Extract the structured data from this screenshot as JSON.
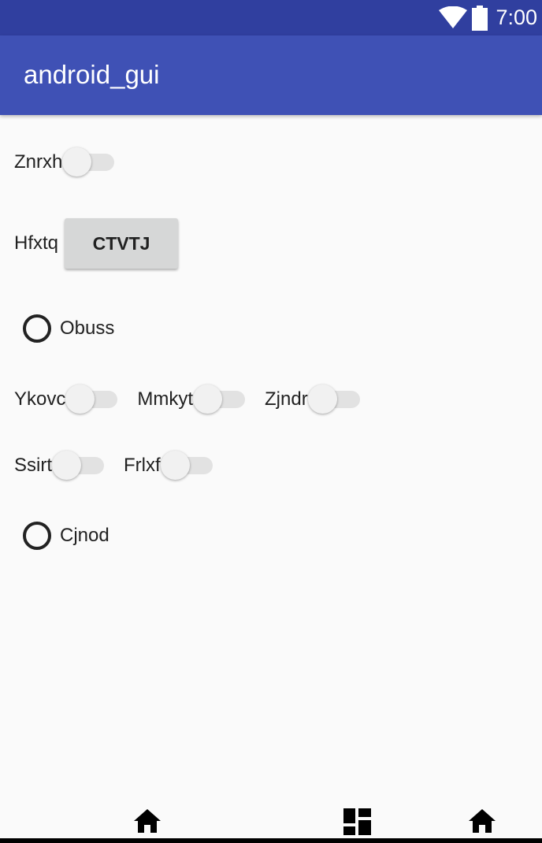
{
  "status_bar": {
    "time": "7:00",
    "icons": [
      "wifi-icon",
      "battery-icon"
    ]
  },
  "app_bar": {
    "title": "android_gui"
  },
  "rows": {
    "row1": {
      "switch_label": "Znrxh"
    },
    "row2": {
      "label": "Hfxtq",
      "button_label": "CTVTJ"
    },
    "row3": {
      "radio_label": "Obuss"
    },
    "row4": {
      "switch1_label": "Ykovc",
      "switch2_label": "Mmkyt",
      "switch3_label": "Zjndr"
    },
    "row5": {
      "switch1_label": "Ssirt",
      "switch2_label": "Frlxf"
    },
    "row6": {
      "radio_label": "Cjnod"
    }
  },
  "nav_bar": {
    "icons": [
      "home-icon",
      "dashboard-icon",
      "home-icon"
    ]
  },
  "colors": {
    "status_bar": "#303f9f",
    "app_bar": "#3f51b5",
    "background": "#fafafa",
    "button": "#d6d7d7"
  }
}
